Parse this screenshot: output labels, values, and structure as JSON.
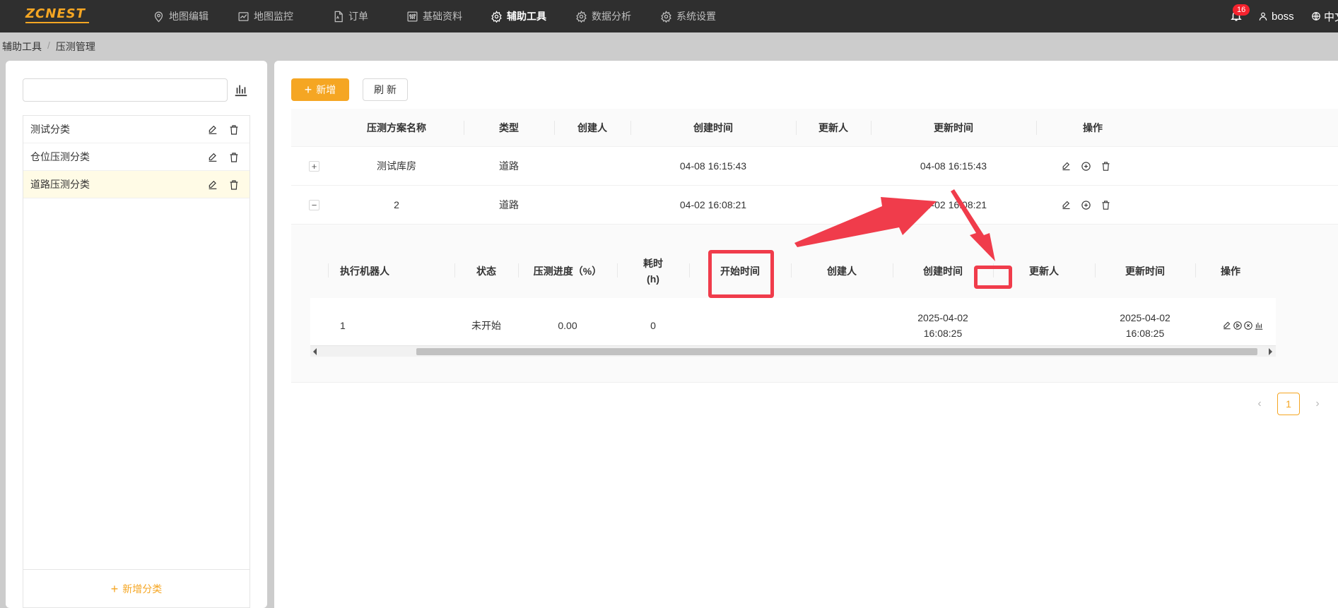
{
  "app": {
    "logo_text": "ZCNEST",
    "brand_color": "#f5a623"
  },
  "topnav": {
    "items": [
      {
        "label": "地图编辑",
        "icon": "map-pin-icon"
      },
      {
        "label": "地图监控",
        "icon": "line-chart-icon"
      },
      {
        "label": "订单",
        "icon": "file-icon"
      },
      {
        "label": "基础资料",
        "icon": "sliders-icon"
      },
      {
        "label": "辅助工具",
        "icon": "gear-icon",
        "active": true
      },
      {
        "label": "数据分析",
        "icon": "gear-icon"
      },
      {
        "label": "系统设置",
        "icon": "gear-icon"
      }
    ],
    "notification_count": "16",
    "user": "boss",
    "language": "中文"
  },
  "breadcrumb": {
    "parent": "辅助工具",
    "separator": "/",
    "current": "压测管理"
  },
  "left_panel": {
    "search_placeholder": "",
    "categories": [
      {
        "label": "测试分类",
        "selected": false
      },
      {
        "label": "仓位压测分类",
        "selected": false
      },
      {
        "label": "道路压测分类",
        "selected": true
      }
    ],
    "add_category_label": "新增分类"
  },
  "toolbar": {
    "add_label": "新增",
    "refresh_label": "刷 新"
  },
  "main_table": {
    "headers": [
      "压测方案名称",
      "类型",
      "创建人",
      "创建时间",
      "更新人",
      "更新时间",
      "操作"
    ],
    "rows": [
      {
        "expander": "+",
        "name": "测试库房",
        "type": "道路",
        "creator": "",
        "created": "04-08 16:15:43",
        "updater": "",
        "updated": "04-08 16:15:43"
      },
      {
        "expander": "−",
        "name": "2",
        "type": "道路",
        "creator": "",
        "created": "04-02 16:08:21",
        "updater": "",
        "updated": "04-02 16:08:21"
      }
    ]
  },
  "sub_table": {
    "headers": [
      "执行机器人",
      "状态",
      "压测进度（%）",
      "耗时\n(h)",
      "开始时间",
      "创建人",
      "创建时间",
      "更新人",
      "更新时间",
      "操作"
    ],
    "rows": [
      {
        "robot": "1",
        "status": "未开始",
        "progress": "0.00",
        "duration": "0",
        "start": "",
        "creator": "",
        "created": "2025-04-02\n16:08:25",
        "updater": "",
        "updated": "2025-04-02\n16:08:25"
      }
    ]
  },
  "pagination": {
    "current_page": "1"
  },
  "annotation_color": "#f03c4b"
}
